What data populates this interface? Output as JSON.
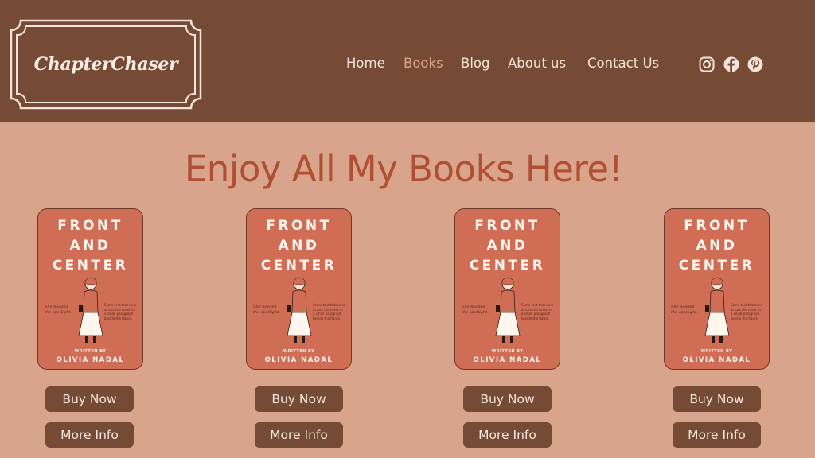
{
  "brand": {
    "logo_text": "ChapterChaser"
  },
  "nav": {
    "items": [
      {
        "label": "Home",
        "active": false
      },
      {
        "label": "Books",
        "active": true
      },
      {
        "label": "Blog",
        "active": false
      },
      {
        "label": "About us",
        "active": false
      },
      {
        "label": "Contact Us",
        "active": false
      }
    ]
  },
  "social": [
    {
      "icon": "instagram-icon"
    },
    {
      "icon": "facebook-icon"
    },
    {
      "icon": "pinterest-icon"
    }
  ],
  "page": {
    "title": "Enjoy All My Books Here!"
  },
  "book_cover": {
    "title_line1": "FRONT",
    "title_line2": "AND",
    "title_line3": "CENTER",
    "tagline": "She needed the spotlight.",
    "blurb": "Some text that runs across the cover in a small paragraph beside the figure.",
    "written_by": "WRITTEN BY",
    "author": "OLIVIA NADAL"
  },
  "books": [
    {
      "buy_label": "Buy Now",
      "info_label": "More Info"
    },
    {
      "buy_label": "Buy Now",
      "info_label": "More Info"
    },
    {
      "buy_label": "Buy Now",
      "info_label": "More Info"
    },
    {
      "buy_label": "Buy Now",
      "info_label": "More Info"
    }
  ],
  "colors": {
    "header_bg": "#754b35",
    "page_bg": "#d8a58c",
    "accent_title": "#b04f31",
    "cover_bg": "#cf6e55",
    "button_bg": "#754b35"
  }
}
